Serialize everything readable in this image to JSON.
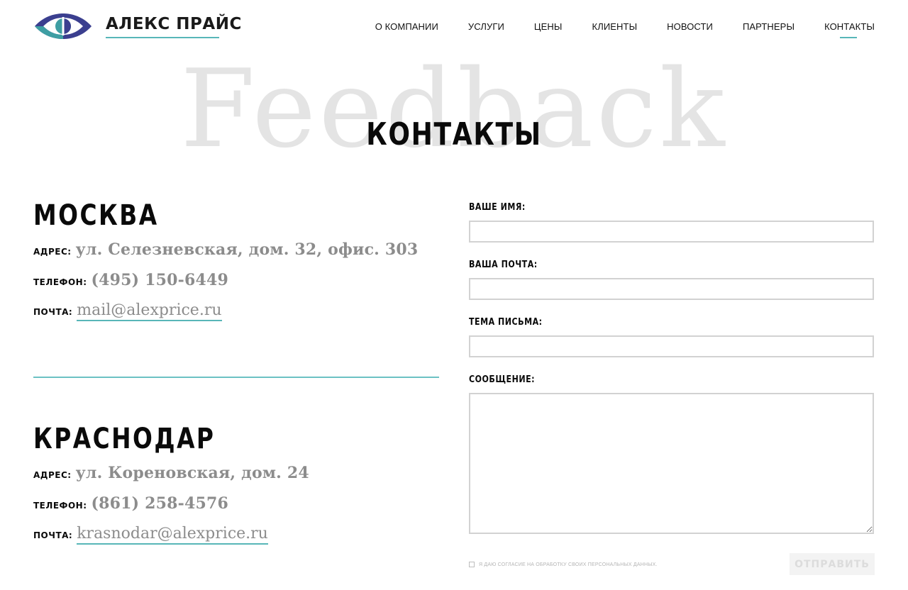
{
  "brand": {
    "name": "АЛЕКС ПРАЙС"
  },
  "nav": [
    {
      "label": "О КОМПАНИИ",
      "active": false
    },
    {
      "label": "УСЛУГИ",
      "active": false
    },
    {
      "label": "ЦЕНЫ",
      "active": false
    },
    {
      "label": "КЛИЕНТЫ",
      "active": false
    },
    {
      "label": "НОВОСТИ",
      "active": false
    },
    {
      "label": "ПАРТНЕРЫ",
      "active": false
    },
    {
      "label": "КОНТАКТЫ",
      "active": true
    }
  ],
  "hero": {
    "watermark": "Feedback",
    "title": "КОНТАКТЫ"
  },
  "offices": [
    {
      "city": "МОСКВА",
      "address_label": "АДРЕС:",
      "address": "ул. Селезневская, дом. 32, офис. 303",
      "phone_label": "ТЕЛЕФОН:",
      "phone": "(495) 150-6449",
      "email_label": "ПОЧТА:",
      "email": "mail@alexprice.ru"
    },
    {
      "city": "КРАСНОДАР",
      "address_label": "АДРЕС:",
      "address": "ул. Кореновская, дом. 24",
      "phone_label": "ТЕЛЕФОН:",
      "phone": "(861) 258-4576",
      "email_label": "ПОЧТА:",
      "email": "krasnodar@alexprice.ru"
    }
  ],
  "form": {
    "name_label": "ВАШЕ ИМЯ:",
    "name_value": "",
    "email_label": "ВАША ПОЧТА:",
    "email_value": "",
    "subject_label": "ТЕМА ПИСЬМА:",
    "subject_value": "",
    "message_label": "СООБЩЕНИЕ:",
    "message_value": "",
    "consent": "Я ДАЮ СОГЛАСИЕ НА ОБРАБОТКУ СВОИХ ПЕРСОНАЛЬНЫХ ДАННЫХ.",
    "consent_checked": false,
    "submit": "ОТПРАВИТЬ"
  },
  "colors": {
    "accent": "#58b6b8",
    "logo_navy": "#3b3f8f",
    "logo_teal": "#3e9ea3",
    "muted_text": "#8c8c8c"
  }
}
